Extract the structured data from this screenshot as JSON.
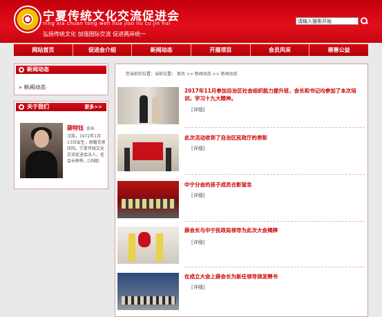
{
  "header": {
    "title": "宁夏传统文化交流促进会",
    "pinyin": "ning xia chuan tong wen hua jiao liu cu jin hui",
    "slogan": "弘扬传统文化   加强国际交流   促进两岸统一",
    "search_value": "请输入搜索开始"
  },
  "nav": [
    "网站首页",
    "促进会介绍",
    "新闻动态",
    "开展项目",
    "会员风采",
    "慈善公益"
  ],
  "sidebar": {
    "news_title": "新闻动态",
    "news_link": "» 新闻动态",
    "about_title": "关于我们",
    "about_more": "更多>>",
    "about_name": "薛特钰",
    "about_role": "会长",
    "about_text": "汉族，1972年1月13日出生，原籍甘肃庆阳。宁夏传统文化交流促进会法人，任会长薛秀...[详细]"
  },
  "breadcrumb": "您当前的位置：当前位置：  首页   >>   新闻动态   >>   新闻动态",
  "articles": [
    {
      "title": "2017年11月参加自治区社会组织能力提升班，会长和书记均参加了本次培训，学习十九大精神。",
      "more": "[详细]"
    },
    {
      "title": "此次活动收到了自治区民政厅的表彰",
      "more": "[详细]"
    },
    {
      "title": "中宁分会的孩子成员合影留念",
      "more": "[详细]"
    },
    {
      "title": "薛会长与中宁民政局领导为此次大会揭牌",
      "more": "[详细]"
    },
    {
      "title": "在成立大会上薛会长为新任领导颁发聘书",
      "more": "[详细]"
    }
  ],
  "colors": {
    "brand_red": "#c8101a",
    "title_red": "#cc0000"
  }
}
